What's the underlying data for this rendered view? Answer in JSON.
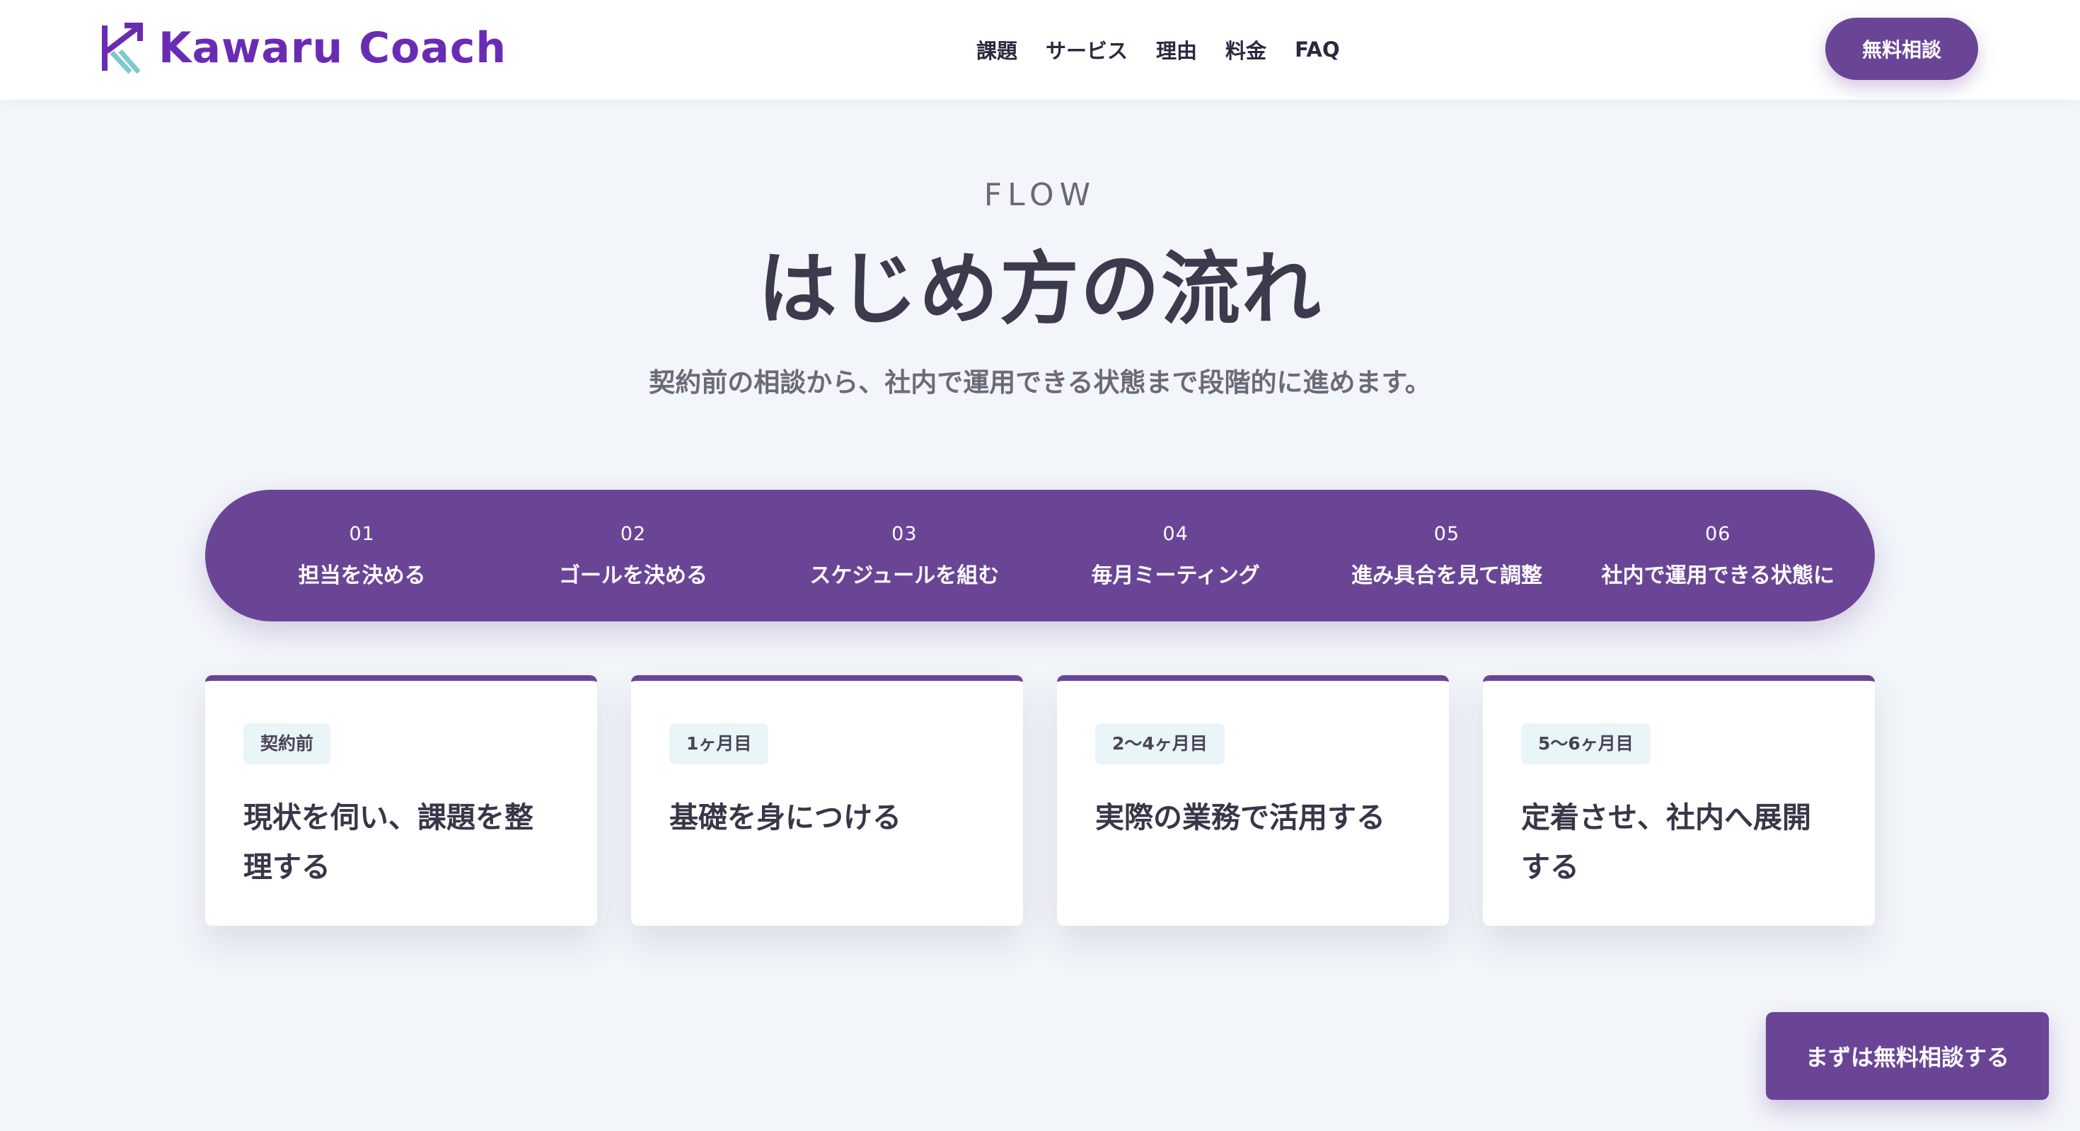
{
  "header": {
    "logo_text": "Kawaru Coach",
    "nav": [
      "課題",
      "サービス",
      "理由",
      "料金",
      "FAQ"
    ],
    "cta_label": "無料相談"
  },
  "section": {
    "eyebrow": "FLOW",
    "title": "はじめ方の流れ",
    "subtitle": "契約前の相談から、社内で運用できる状態まで段階的に進めます。"
  },
  "steps": [
    {
      "num": "01",
      "label": "担当を決める"
    },
    {
      "num": "02",
      "label": "ゴールを決める"
    },
    {
      "num": "03",
      "label": "スケジュールを組む"
    },
    {
      "num": "04",
      "label": "毎月ミーティング"
    },
    {
      "num": "05",
      "label": "進み具合を見て調整"
    },
    {
      "num": "06",
      "label": "社内で運用できる状態に"
    }
  ],
  "cards": [
    {
      "badge": "契約前",
      "text": "現状を伺い、課題を整理する"
    },
    {
      "badge": "1ヶ月目",
      "text": "基礎を身につける"
    },
    {
      "badge": "2〜4ヶ月目",
      "text": "実際の業務で活用する"
    },
    {
      "badge": "5〜6ヶ月目",
      "text": "定着させ、社内へ展開する"
    }
  ],
  "floating_cta": "まずは無料相談する",
  "colors": {
    "brand": "#6a2bb4",
    "accent": "#6a4596",
    "logo_teal": "#7cc9cf",
    "background": "#f2f5fa"
  }
}
